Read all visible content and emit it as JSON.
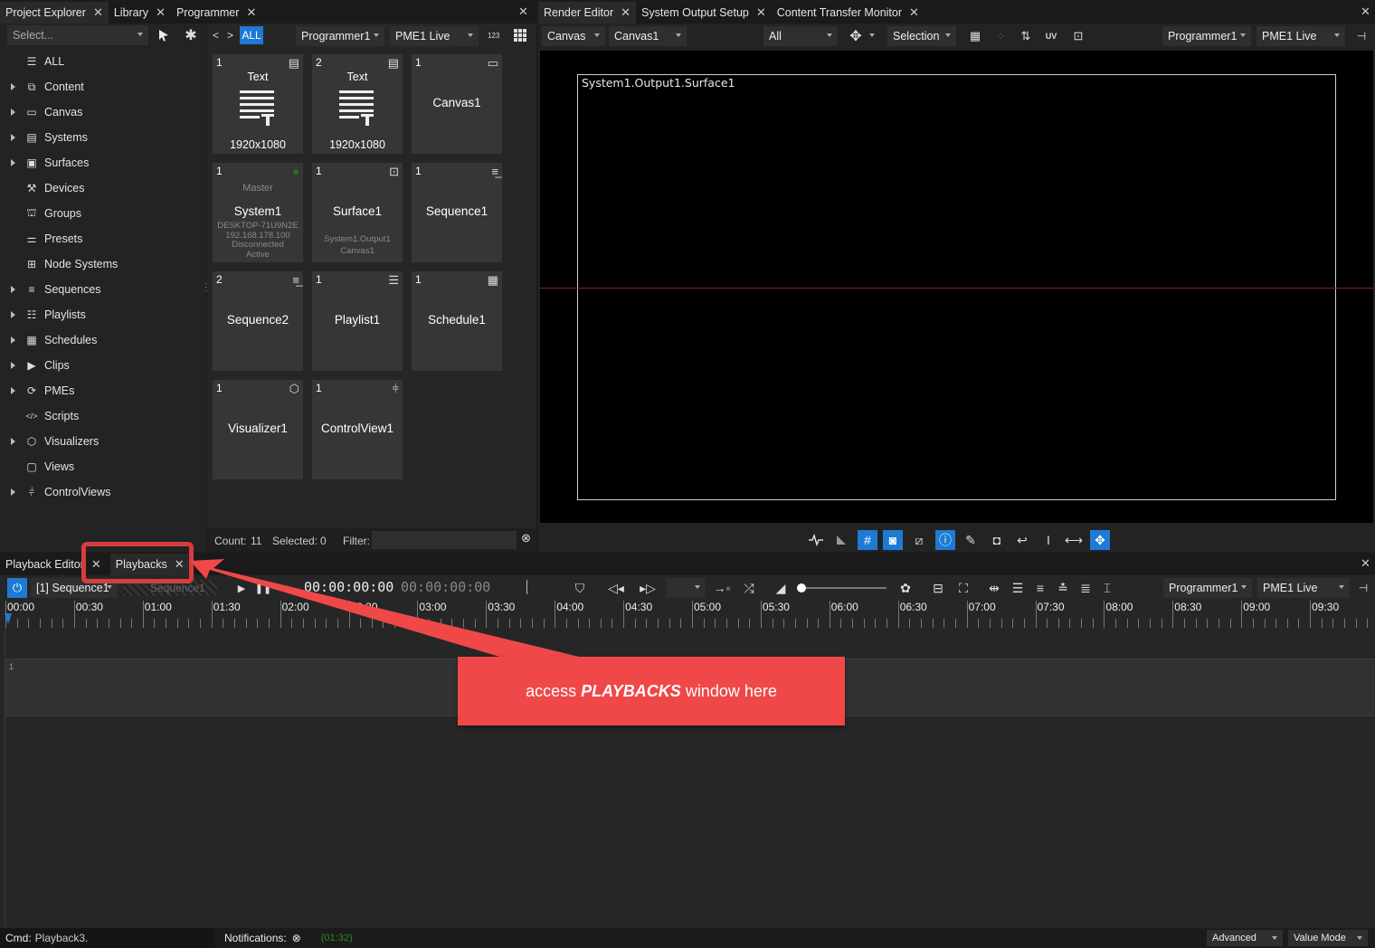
{
  "left_tabs": [
    {
      "label": "Project Explorer"
    },
    {
      "label": "Library"
    },
    {
      "label": "Programmer"
    }
  ],
  "right_tabs": [
    {
      "label": "Render Editor"
    },
    {
      "label": "System Output Setup"
    },
    {
      "label": "Content Transfer Monitor"
    }
  ],
  "explorer": {
    "select_placeholder": "Select...",
    "tree": [
      {
        "label": "ALL",
        "icon": "database-icon",
        "expandable": false
      },
      {
        "label": "Content",
        "icon": "content-icon",
        "expandable": true
      },
      {
        "label": "Canvas",
        "icon": "canvas-icon",
        "expandable": true
      },
      {
        "label": "Systems",
        "icon": "systems-icon",
        "expandable": true
      },
      {
        "label": "Surfaces",
        "icon": "surfaces-icon",
        "expandable": true
      },
      {
        "label": "Devices",
        "icon": "devices-icon",
        "expandable": false
      },
      {
        "label": "Groups",
        "icon": "groups-icon",
        "expandable": false
      },
      {
        "label": "Presets",
        "icon": "presets-icon",
        "expandable": false
      },
      {
        "label": "Node Systems",
        "icon": "node-systems-icon",
        "expandable": false
      },
      {
        "label": "Sequences",
        "icon": "sequences-icon",
        "expandable": true
      },
      {
        "label": "Playlists",
        "icon": "playlists-icon",
        "expandable": true
      },
      {
        "label": "Schedules",
        "icon": "schedules-icon",
        "expandable": true
      },
      {
        "label": "Clips",
        "icon": "clips-icon",
        "expandable": true
      },
      {
        "label": "PMEs",
        "icon": "pmes-icon",
        "expandable": true
      },
      {
        "label": "Scripts",
        "icon": "scripts-icon",
        "expandable": false
      },
      {
        "label": "Visualizers",
        "icon": "visualizers-icon",
        "expandable": true
      },
      {
        "label": "Views",
        "icon": "views-icon",
        "expandable": false
      },
      {
        "label": "ControlViews",
        "icon": "controlviews-icon",
        "expandable": true
      }
    ]
  },
  "library": {
    "nav_prev": "<",
    "nav_next": ">",
    "all_label": "ALL",
    "programmer": "Programmer1",
    "pme": "PME1 Live",
    "counter_label": "123",
    "tiles": [
      {
        "num": "1",
        "name": "Text",
        "sub": "1920x1080",
        "kind": "text",
        "icon": "text-icon"
      },
      {
        "num": "2",
        "name": "Text",
        "sub": "1920x1080",
        "kind": "text",
        "icon": "text-icon"
      },
      {
        "num": "1",
        "name": "Canvas1",
        "kind": "plain",
        "icon": "canvas-icon"
      },
      {
        "num": "1",
        "name": "System1",
        "master": "Master",
        "lines": [
          "DESKTOP-71U9N2E",
          "192.168.178.100",
          "Disconnected",
          "Active"
        ],
        "kind": "system",
        "icon": "network-icon"
      },
      {
        "num": "1",
        "name": "Surface1",
        "lines": [
          "System1.Output1",
          "Canvas1"
        ],
        "kind": "surface",
        "icon": "surface-icon"
      },
      {
        "num": "1",
        "name": "Sequence1",
        "kind": "plain",
        "icon": "sequence-icon"
      },
      {
        "num": "2",
        "name": "Sequence2",
        "kind": "plain",
        "icon": "sequence-icon"
      },
      {
        "num": "1",
        "name": "Playlist1",
        "kind": "plain",
        "icon": "playlist-icon"
      },
      {
        "num": "1",
        "name": "Schedule1",
        "kind": "plain",
        "icon": "schedule-icon"
      },
      {
        "num": "1",
        "name": "Visualizer1",
        "kind": "plain",
        "icon": "visualizer-icon"
      },
      {
        "num": "1",
        "name": "ControlView1",
        "kind": "plain",
        "icon": "controlview-icon"
      }
    ],
    "count_label": "Count:",
    "count": "11",
    "selected_label": "Selected:",
    "selected": "0",
    "filter_label": "Filter:"
  },
  "render": {
    "mode": "Canvas",
    "canvas": "Canvas1",
    "filter": "All",
    "selection": "Selection",
    "programmer": "Programmer1",
    "pme": "PME1 Live",
    "uv_label": "UV",
    "surface_label": "System1.Output1.Surface1"
  },
  "bottom_tabs": [
    {
      "label": "Playback Editor"
    },
    {
      "label": "Playbacks"
    }
  ],
  "playback": {
    "sequence": "[1] Sequence1",
    "sequence_ghost": "Sequence1",
    "timecode": "00:00:00:00",
    "timecode2": "00:00:00:00",
    "programmer": "Programmer1",
    "pme": "PME1 Live",
    "ruler": [
      "00:00",
      "00:30",
      "01:00",
      "01:30",
      "02:00",
      "02:30",
      "03:00",
      "03:30",
      "04:00",
      "04:30",
      "05:00",
      "05:30",
      "06:00",
      "06:30",
      "07:00",
      "07:30",
      "08:00",
      "08:30",
      "09:00",
      "09:30"
    ],
    "track_number": "1"
  },
  "callout": {
    "prefix": "access ",
    "emphasis": "PLAYBACKS",
    "suffix": " window here",
    "color": "#f04848",
    "highlight_color": "#d93c3c"
  },
  "status": {
    "cmd_label": "Cmd:",
    "cmd_value": "Playback3.",
    "notifications_label": "Notifications:",
    "time": "(01:32)",
    "advanced": "Advanced",
    "value_mode": "Value Mode"
  }
}
